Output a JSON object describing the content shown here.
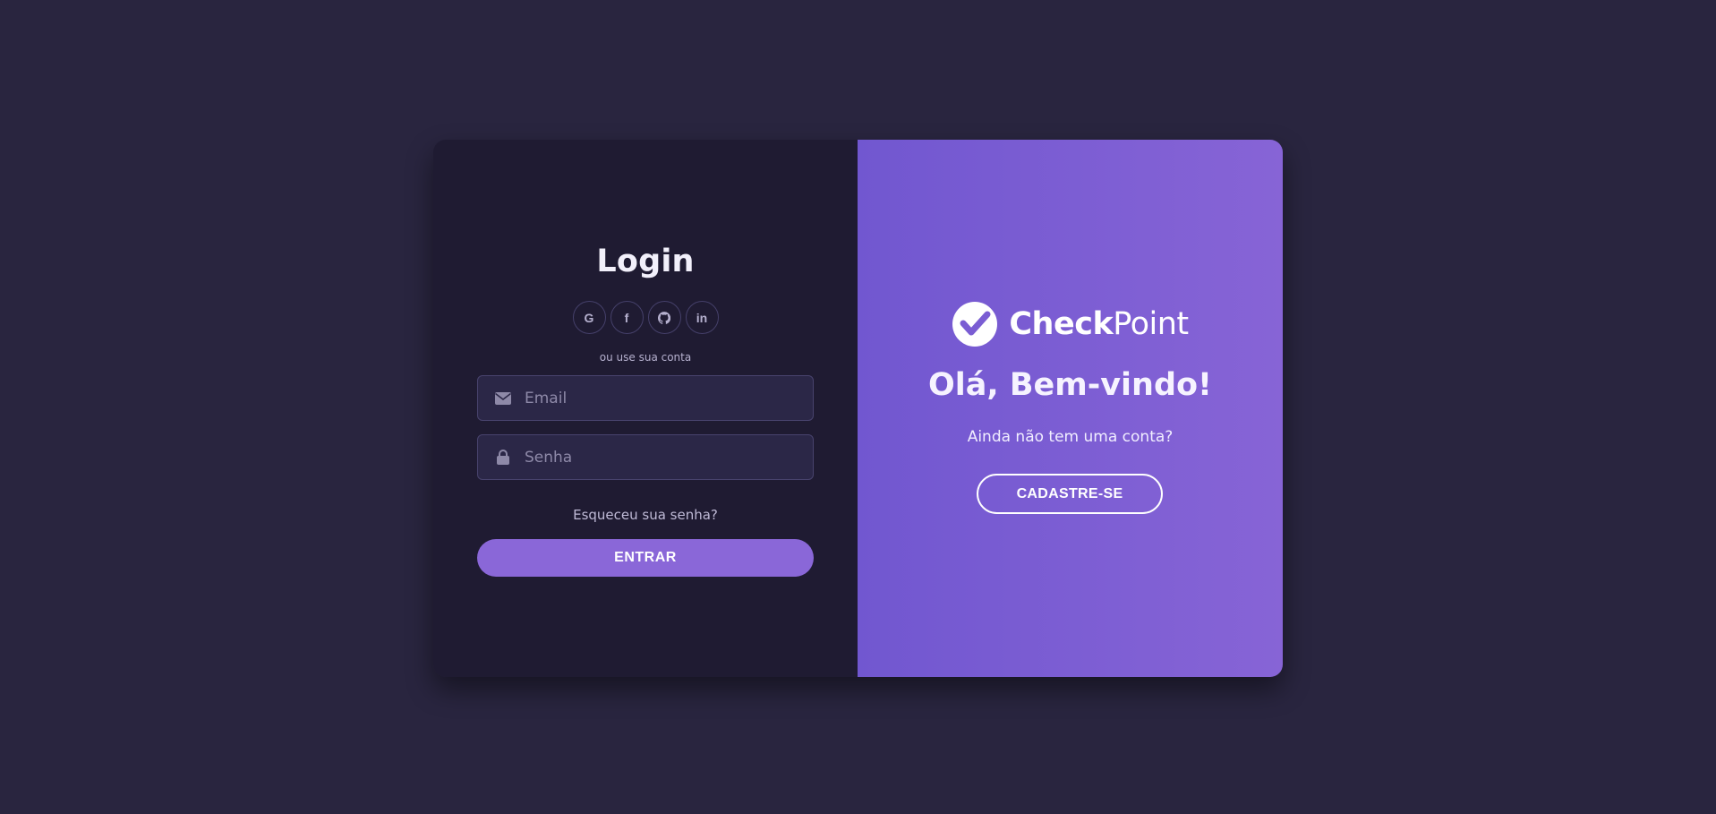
{
  "login": {
    "title": "Login",
    "socials": [
      {
        "icon": "google-icon",
        "glyph": "G"
      },
      {
        "icon": "facebook-icon",
        "glyph": "f"
      },
      {
        "icon": "github-icon",
        "glyph": ""
      },
      {
        "icon": "linkedin-icon",
        "glyph": "in"
      }
    ],
    "alt_text": "ou use sua conta",
    "email": {
      "placeholder": "Email",
      "value": "",
      "icon": "envelope-icon"
    },
    "password": {
      "placeholder": "Senha",
      "value": "",
      "icon": "lock-icon"
    },
    "forgot_link": "Esqueceu sua senha?",
    "submit_label": "ENTRAR"
  },
  "welcome_panel": {
    "brand_bold": "Check",
    "brand_light": "Point",
    "logo_icon": "checkpoint-logo-icon",
    "heading": "Olá, Bem-vindo!",
    "subtext": "Ainda não tem uma conta?",
    "signup_label": "CADASTRE-SE"
  },
  "colors": {
    "page_bg": "#29253f",
    "panel_bg": "#1f1b32",
    "accent": "#8a67d8",
    "gradient_start": "#7157d0",
    "gradient_end": "#8764d6"
  }
}
